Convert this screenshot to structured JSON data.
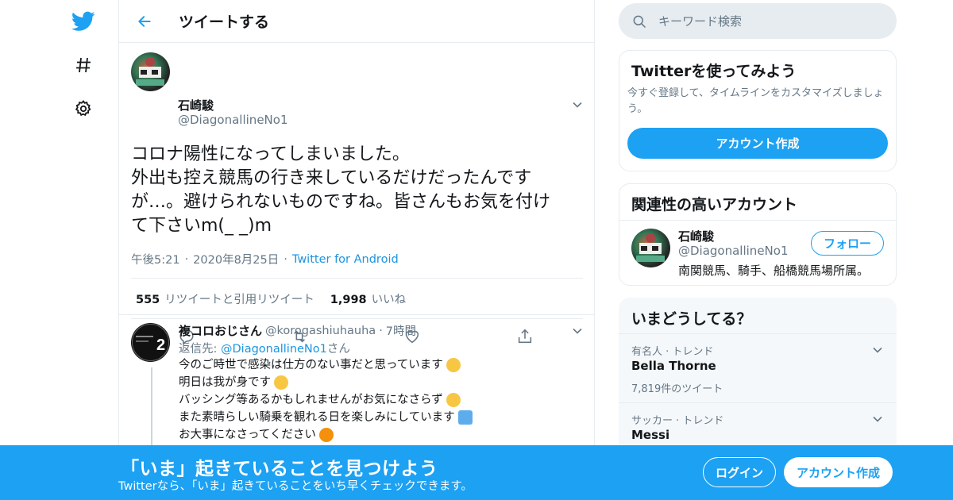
{
  "header": {
    "title": "ツイートする"
  },
  "tweet": {
    "author_name": "石崎駿",
    "author_handle": "@DiagonallineNo1",
    "text": "コロナ陽性になってしまいました。\n外出も控え競馬の行き来しているだけだったんです\nが…。避けられないものですね。皆さんもお気を付け\nて下さいm(_ _)m",
    "time": "午後5:21",
    "date": "2020年8月25日",
    "source": "Twitter for Android",
    "retweets_count": "555",
    "retweets_label": "リツイートと引用リツイート",
    "likes_count": "1,998",
    "likes_label": "いいね"
  },
  "reply": {
    "author_name": "複コロおじさん",
    "author_handle": "@korogashiuhauha",
    "time_ago": "7時間",
    "reply_to_prefix": "返信先: ",
    "reply_to_handle": "@DiagonallineNo1",
    "reply_to_suffix": "さん",
    "avatar_number": "2",
    "lines": [
      {
        "text": "今のご時世で感染は仕方のない事だと思っています",
        "emoji": "anxious-face-emoji",
        "emoji_color": "#f7c744"
      },
      {
        "text": "明日は我が身です",
        "emoji": "sweat-smile-emoji",
        "emoji_color": "#f7c744"
      },
      {
        "text": "バッシング等あるかもしれませんがお気になさらず",
        "emoji": "raised-fist-emoji",
        "emoji_color": "#f7c744"
      },
      {
        "text": "また素晴らしい騎乗を観れる日を楽しみにしています",
        "emoji": "musical-notes-emoji",
        "emoji_color": "#5dadec"
      },
      {
        "text": "お大事になさってください",
        "emoji": "bowing-person-emoji",
        "emoji_color": "#f4900c"
      }
    ]
  },
  "search": {
    "placeholder": "キーワード検索"
  },
  "signup_card": {
    "title": "Twitterを使ってみよう",
    "description": "今すぐ登録して、タイムラインをカスタマイズしましょう。",
    "button": "アカウント作成"
  },
  "related_card": {
    "title": "関連性の高いアカウント",
    "name": "石崎駿",
    "handle": "@DiagonallineNo1",
    "bio": "南関競馬、騎手、船橋競馬場所属。",
    "follow_button": "フォロー"
  },
  "trends_card": {
    "title": "いまどうしてる？",
    "items": [
      {
        "category": "有名人 · トレンド",
        "name": "Bella Thorne",
        "count": "7,819件のツイート"
      },
      {
        "category": "サッカー · トレンド",
        "name": "Messi",
        "count": ""
      }
    ]
  },
  "banner": {
    "title": "「いま」起きていることを見つけよう",
    "subtitle": "Twitterなら、「いま」起きていることをいち早くチェックできます。",
    "login": "ログイン",
    "signup": "アカウント作成"
  },
  "colors": {
    "accent": "#1da1f2",
    "link": "#1b95e0",
    "muted_text": "#657786",
    "border": "#e6ecf0"
  }
}
